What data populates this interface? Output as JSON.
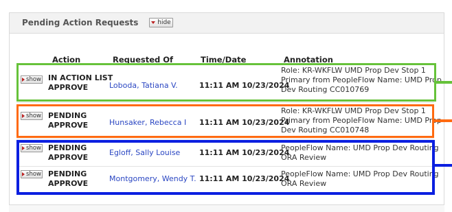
{
  "panel": {
    "title": "Pending Action Requests",
    "hide_label": "hide"
  },
  "columns": {
    "action": "Action",
    "requested_of": "Requested Of",
    "time_date": "Time/Date",
    "annotation": "Annotation"
  },
  "rows": [
    {
      "show_label": "show",
      "action_line1": "IN ACTION LIST",
      "action_line2": "APPROVE",
      "requested_of": "Loboda, Tatiana V.",
      "time": "11:11 AM 10/23/2024",
      "annotation_lines": [
        "Role: KR-WKFLW UMD Prop Dev Stop 1",
        "Primary from PeopleFlow Name: UMD Prop",
        "Dev Routing CC010769"
      ]
    },
    {
      "show_label": "show",
      "action_line1": "PENDING",
      "action_line2": "APPROVE",
      "requested_of": "Hunsaker, Rebecca I",
      "time": "11:11 AM 10/23/2024",
      "annotation_lines": [
        "Role: KR-WKFLW UMD Prop Dev Stop 1",
        "Primary from PeopleFlow Name: UMD Prop",
        "Dev Routing CC010748"
      ]
    },
    {
      "show_label": "show",
      "action_line1": "PENDING",
      "action_line2": "APPROVE",
      "requested_of": "Egloff, Sally Louise",
      "time": "11:11 AM 10/23/2024",
      "annotation_lines": [
        "PeopleFlow Name: UMD Prop Dev Routing",
        "ORA Review"
      ]
    },
    {
      "show_label": "show",
      "action_line1": "PENDING",
      "action_line2": "APPROVE",
      "requested_of": "Montgomery, Wendy T.",
      "time": "11:11 AM 10/23/2024",
      "annotation_lines": [
        "PeopleFlow Name: UMD Prop Dev Routing",
        "ORA Review"
      ]
    }
  ],
  "highlight_colors": {
    "green": "#66c23a",
    "orange": "#ff6a10",
    "blue": "#0b1fe0"
  }
}
